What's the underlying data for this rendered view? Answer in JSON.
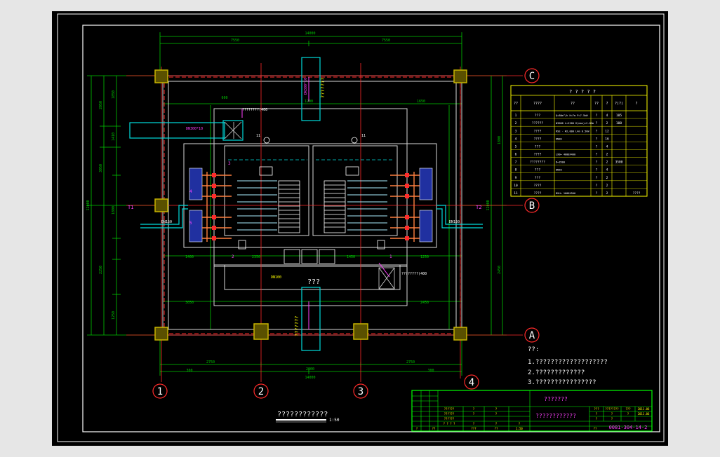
{
  "colors": {
    "background": "#e6e6e6",
    "sheet": "#000000",
    "border": "#ffffff",
    "dimension": "#00c800",
    "axis": "#ff2a2a",
    "column": "#c8b400",
    "pipe": "#00dcdc",
    "text": "#ffffff",
    "magenta": "#ff40ff",
    "yellow": "#ffff00",
    "titleblock": "#00ff00"
  },
  "axes": {
    "vertical": [
      "1",
      "2",
      "3",
      "4"
    ],
    "horizontal": [
      "C",
      "B",
      "A"
    ]
  },
  "dimensions": {
    "overall_width": "14000",
    "top_left_half": "7550",
    "top_right_half": "7550",
    "bottom_total": "14000",
    "bottom_left": "2750",
    "bottom_right": "2750",
    "left_overall": "12000",
    "right_overall": "12000",
    "seg_1": "2000",
    "seg_2": "1410",
    "seg_3": "2050",
    "seg_4": "3050",
    "seg_5": "2250",
    "seg_6": "1850",
    "seg_7": "1250",
    "seg_8": "300",
    "seg_9": "2350",
    "seg_10": "1400",
    "seg_11": "1450",
    "seg_12": "1200",
    "seg_13": "1800",
    "seg_14": "3050",
    "seg_15": "2450",
    "seg_16": "1650",
    "seg_17": "600"
  },
  "labels": {
    "room_label": "???",
    "pipe_in_top": "???????",
    "pipe_out_bottom": "???????",
    "pipe_left": "DN150",
    "pipe_right": "DN150",
    "pipe_spec_top": "DN300*10",
    "pipe_spec_left": "DN300*10",
    "pipe_spec_mid": "DN100",
    "note_top": "????????(400",
    "note_bottom": "????????(400",
    "tank_tag_1": "11",
    "tank_tag_2": "11",
    "tag_a": "4",
    "tag_b": "5",
    "tag_c": "2",
    "tag_d": "1",
    "tag_e": "3",
    "elev_left": "T1",
    "elev_right": "T2"
  },
  "equipment_table": {
    "title": "? ? ? ? ?",
    "headers": [
      "??",
      "????",
      "??",
      "??",
      "?",
      "?(?)",
      "?"
    ],
    "subheader": "?",
    "rows": [
      {
        "no": "1",
        "name": "???",
        "spec": "Q=80m³/h H=7m P=7.5kW",
        "unit": "?",
        "qty": "4",
        "w1": "105",
        "remark": ""
      },
      {
        "no": "2",
        "name": "??????",
        "spec": "Φ3000 L=2200 H(max)=2.05m",
        "unit": "?",
        "qty": "2",
        "w1": "100",
        "remark": ""
      },
      {
        "no": "3",
        "name": "????",
        "spec": "RSE - Φ2,000 L4m 0.5kW",
        "unit": "?",
        "qty": "12",
        "w1": "",
        "remark": ""
      },
      {
        "no": "4",
        "name": "????",
        "spec": "DN80",
        "unit": "?",
        "qty": "16",
        "w1": "",
        "remark": ""
      },
      {
        "no": "5",
        "name": "???",
        "spec": "",
        "unit": "?",
        "qty": "4",
        "w1": "",
        "remark": ""
      },
      {
        "no": "6",
        "name": "????",
        "spec": "LXB= 4000X400",
        "unit": "?",
        "qty": "2",
        "w1": "",
        "remark": ""
      },
      {
        "no": "7",
        "name": "????????",
        "spec": "D=3500",
        "unit": "?",
        "qty": "2",
        "w1": "3500",
        "remark": ""
      },
      {
        "no": "8",
        "name": "???",
        "spec": "DN50",
        "unit": "?",
        "qty": "4",
        "w1": "",
        "remark": ""
      },
      {
        "no": "9",
        "name": "???",
        "spec": "",
        "unit": "?",
        "qty": "2",
        "w1": "",
        "remark": ""
      },
      {
        "no": "10",
        "name": "????",
        "spec": "",
        "unit": "?",
        "qty": "2",
        "w1": "",
        "remark": ""
      },
      {
        "no": "11",
        "name": "????",
        "spec": "BXH= 1000X500",
        "unit": "?",
        "qty": "2",
        "w1": "",
        "remark": "????"
      }
    ]
  },
  "notes": {
    "heading": "??:",
    "items": [
      "1.???????????????????",
      "2.?????????????",
      "3.????????????????"
    ]
  },
  "drawing_title": "????????????",
  "scale": "1:50",
  "title_block": {
    "project": "???????",
    "drawing_name": "????????????",
    "drawing_number": "0081-304-14-2",
    "rev_cells": [
      "???",
      "????????",
      "???",
      "2011.06",
      "?",
      "?",
      "?",
      "2011.06",
      "?",
      "?"
    ],
    "sign_cells": [
      "??????",
      "?",
      "?",
      "??????",
      "?",
      "?",
      "??????",
      "? ? ? ?",
      "?",
      "?",
      "?"
    ],
    "bottom_cells": [
      "?",
      "??",
      "???",
      "??",
      "1:50",
      "??"
    ]
  }
}
